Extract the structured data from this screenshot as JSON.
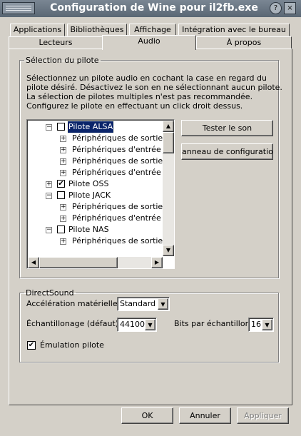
{
  "window": {
    "title": "Configuration de Wine pour il2fb.exe",
    "help_label": "?",
    "close_label": "×"
  },
  "tabs_row1": [
    "Applications",
    "Bibliothèques",
    "Affichage",
    "Intégration avec le bureau"
  ],
  "tabs_row2": [
    "Lecteurs",
    "Audio",
    "À propos"
  ],
  "active_tab": "Audio",
  "driver_selection": {
    "legend": "Sélection du pilote",
    "description": [
      "Sélectionnez un pilote audio en cochant la case en regard du",
      "pilote désiré. Désactivez le son en ne sélectionnant aucun pilote.",
      "La sélection de pilotes multiples n'est pas recommandée.",
      "Configurez le pilote en effectuant un click droit dessus."
    ],
    "tree": [
      {
        "label": "Pilote ALSA",
        "level": 0,
        "expanded": true,
        "checked": false,
        "selected": true
      },
      {
        "label": "Périphériques de sortie W",
        "level": 1
      },
      {
        "label": "Périphériques d'entrée Wa",
        "level": 1
      },
      {
        "label": "Périphériques de sortie M",
        "level": 1
      },
      {
        "label": "Périphériques d'entrée MI",
        "level": 1
      },
      {
        "label": "Pilote OSS",
        "level": 0,
        "expanded": false,
        "checked": true
      },
      {
        "label": "Pilote JACK",
        "level": 0,
        "expanded": true,
        "checked": false
      },
      {
        "label": "Périphériques de sortie W",
        "level": 1
      },
      {
        "label": "Périphériques d'entrée Wa",
        "level": 1
      },
      {
        "label": "Pilote NAS",
        "level": 0,
        "expanded": true,
        "checked": false
      },
      {
        "label": "Périphériques de sortie W",
        "level": 1
      }
    ],
    "test_button": "Tester le son",
    "config_button": "anneau de configuratio"
  },
  "directsound": {
    "legend": "DirectSound",
    "hw_accel_label": "Accélération matérielle :",
    "hw_accel_value": "Standard",
    "sample_rate_label": "Échantillonage (défaut)",
    "sample_rate_value": "44100",
    "bits_label": "Bits par échantillon",
    "bits_value": "16",
    "emulation_label": "Émulation pilote",
    "emulation_checked": true
  },
  "footer": {
    "ok": "OK",
    "cancel": "Annuler",
    "apply": "Appliquer"
  }
}
